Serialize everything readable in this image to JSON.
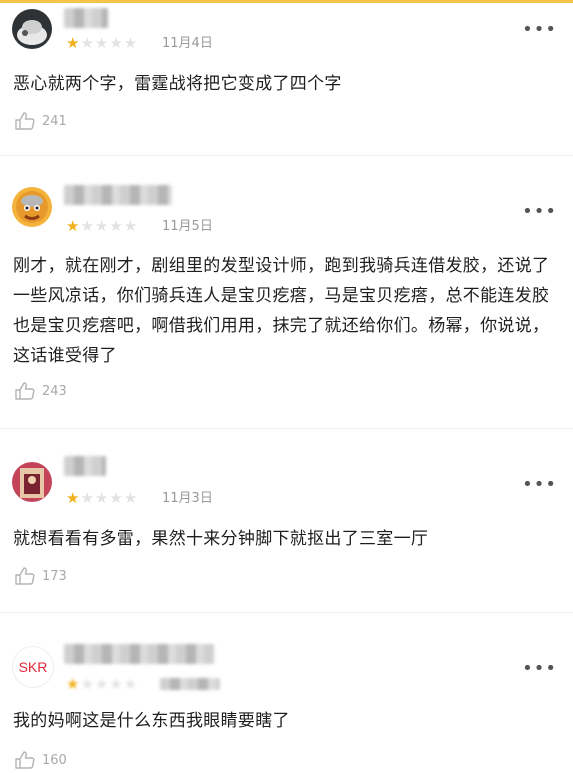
{
  "colors": {
    "star_on": "#f2b01e",
    "star_off": "#e3e3e3",
    "muted": "#9a9a9a"
  },
  "more_glyph": "•••",
  "comments": [
    {
      "avatar_icon": "avatar-icon",
      "rating": 1,
      "date": "11月4日",
      "text": "恶心就两个字，雷霆战将把它变成了四个字",
      "likes": "241"
    },
    {
      "avatar_icon": "avatar-icon",
      "rating": 1,
      "date": "11月5日",
      "text": "刚才，就在刚才，剧组里的发型设计师，跑到我骑兵连借发胶，还说了一些风凉话，你们骑兵连人是宝贝疙瘩，马是宝贝疙瘩，总不能连发胶也是宝贝疙瘩吧，啊借我们用用，抹完了就还给你们。杨幂，你说说，这话谁受得了",
      "likes": "243"
    },
    {
      "avatar_icon": "avatar-icon",
      "rating": 1,
      "date": "11月3日",
      "text": "就想看看有多雷，果然十来分钟脚下就抠出了三室一厅",
      "likes": "173"
    },
    {
      "avatar_icon": "avatar-icon",
      "avatar_text": "SKR",
      "rating": 1,
      "date": "",
      "text": "我的妈啊这是什么东西我眼睛要瞎了",
      "likes": "160"
    }
  ]
}
